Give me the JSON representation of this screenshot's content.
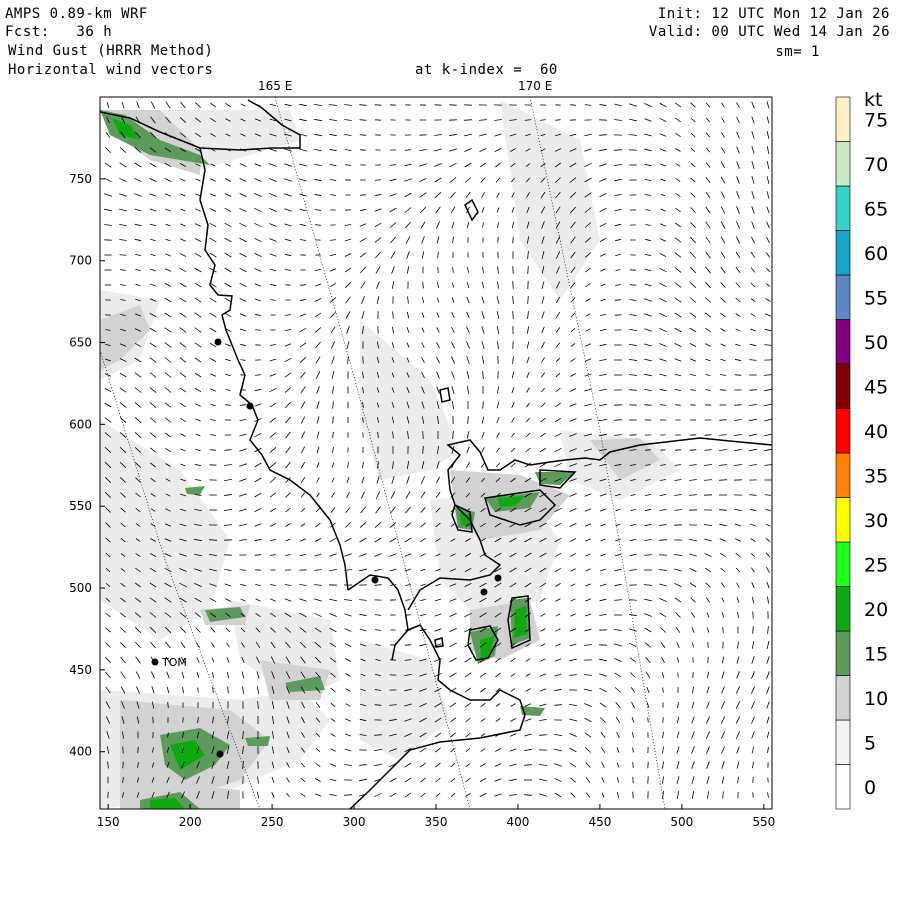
{
  "header": {
    "model": "AMPS 0.89-km WRF",
    "forecast": "Fcst:   36 h",
    "field": "Wind Gust (HRRR Method)",
    "vectors": "Horizontal wind vectors",
    "init": "Init: 12 UTC Mon 12 Jan 26",
    "valid": "Valid: 00 UTC Wed 14 Jan 26",
    "smoothing": "sm= 1",
    "level": "at k-index =  60"
  },
  "map": {
    "longitude_labels": [
      "165 E",
      "170 E"
    ],
    "x_ticks": [
      "150",
      "200",
      "250",
      "300",
      "350",
      "400",
      "450",
      "500",
      "550"
    ],
    "y_ticks": [
      "400",
      "450",
      "500",
      "550",
      "600",
      "650",
      "700",
      "750"
    ],
    "station_label": "TOM",
    "x_range": [
      145,
      555
    ],
    "y_range": [
      365,
      800
    ]
  },
  "colorbar": {
    "unit": "kt",
    "levels": [
      "0",
      "5",
      "10",
      "15",
      "20",
      "25",
      "30",
      "35",
      "40",
      "45",
      "50",
      "55",
      "60",
      "65",
      "70",
      "75"
    ],
    "colors": [
      "#ffffff",
      "#f2f2f2",
      "#d2d2d2",
      "#5c9b5c",
      "#10a810",
      "#1eff1e",
      "#ffff00",
      "#ff8000",
      "#ff0000",
      "#800000",
      "#800080",
      "#5f87c8",
      "#1aa3c8",
      "#38d0c8",
      "#c8e8c8",
      "#fff0c8"
    ]
  }
}
